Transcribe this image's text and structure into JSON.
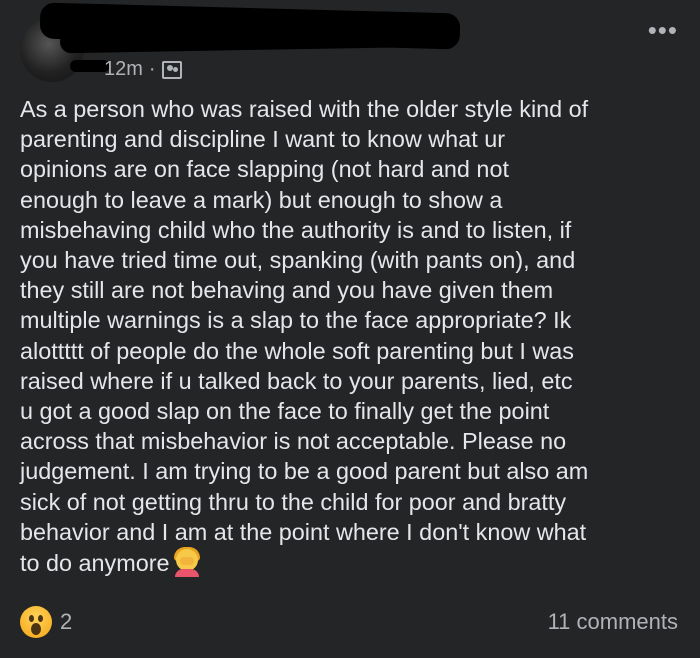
{
  "post": {
    "timestamp": "12m",
    "separator": "·",
    "audience_icon": "group-icon",
    "more_label": "•••",
    "body": "As a person who was raised with the older style kind of\nparenting and discipline I want to know what ur\nopinions are on face slapping (not hard and not\nenough to leave a mark) but enough to show a\nmisbehaving child who the authority is and to listen, if\nyou have tried time out, spanking (with pants on), and\nthey still are not behaving and you have given them\nmultiple warnings is a slap to the face appropriate? Ik\nalottttt of people do the whole soft parenting but I was\nraised where if u talked back to your parents, lied, etc\nu got a good slap on the face to finally get the point\nacross that misbehavior is not acceptable. Please no\njudgement. I am trying to be a good parent but also am\nsick of not getting thru to the child for poor and bratty\nbehavior and I am at the point where I don't know what\nto do anymore",
    "trailing_emoji": "woman-facepalming-emoji"
  },
  "footer": {
    "reaction_icon": "wow-reaction-icon",
    "reaction_count": "2",
    "comments": "11 comments"
  },
  "colors": {
    "background": "#242526",
    "text": "#e4e6eb",
    "secondary_text": "#b0b3b8"
  }
}
